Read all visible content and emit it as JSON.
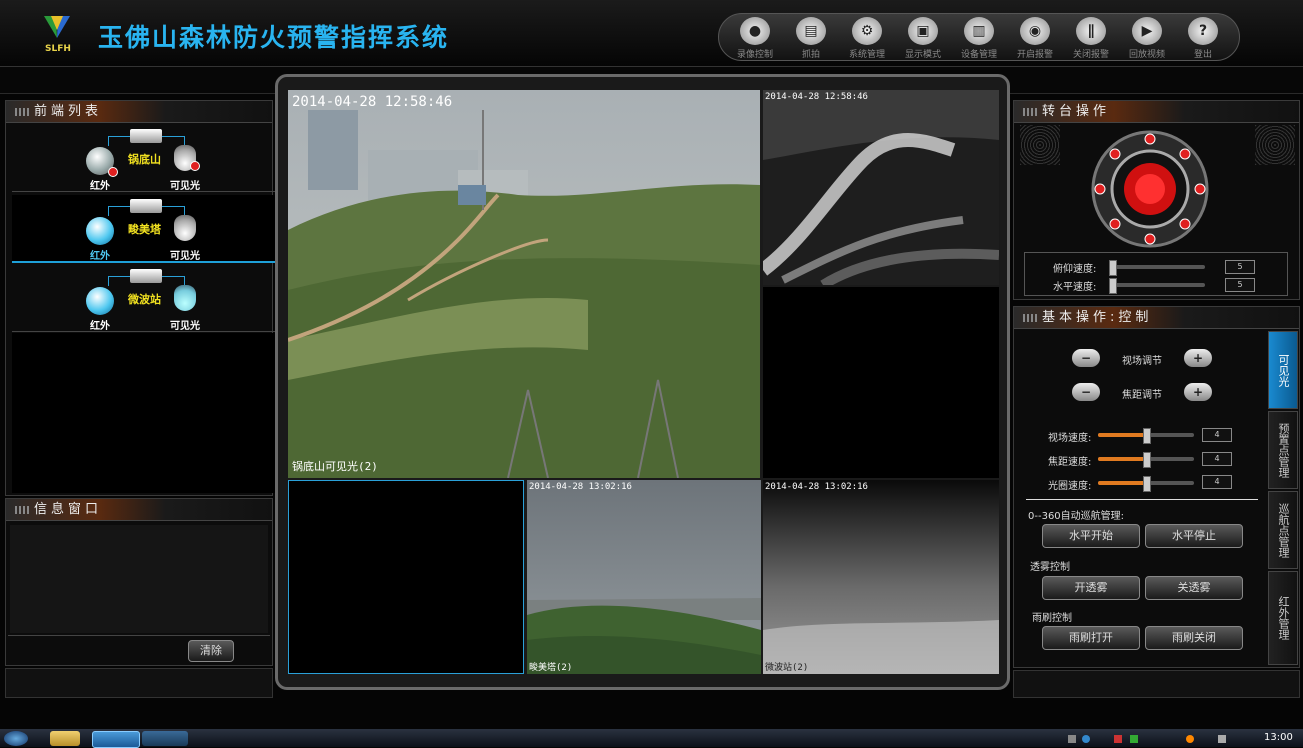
{
  "app": {
    "logo_text": "SLFH",
    "title": "玉佛山森林防火预警指挥系统"
  },
  "toolbar": [
    {
      "label": "录像控制",
      "icon": "video-control-icon",
      "glyph": "●"
    },
    {
      "label": "抓拍",
      "icon": "snapshot-icon",
      "glyph": "▤"
    },
    {
      "label": "系统管理",
      "icon": "system-settings-icon",
      "glyph": "⚙"
    },
    {
      "label": "显示模式",
      "icon": "display-mode-icon",
      "glyph": "▣"
    },
    {
      "label": "设备管理",
      "icon": "device-management-icon",
      "glyph": "▥"
    },
    {
      "label": "开启报警",
      "icon": "alarm-on-icon",
      "glyph": "◉"
    },
    {
      "label": "关闭报警",
      "icon": "alarm-off-icon",
      "glyph": "∥"
    },
    {
      "label": "回放视频",
      "icon": "playback-icon",
      "glyph": "▶"
    },
    {
      "label": "登出",
      "icon": "help-logout-icon",
      "glyph": "?"
    }
  ],
  "front_list": {
    "title": "前端列表",
    "devices": [
      {
        "name": "锅底山",
        "ir_label": "红外",
        "visible_label": "可见光",
        "selected": false,
        "offline": true
      },
      {
        "name": "畯美塔",
        "ir_label": "红外",
        "visible_label": "可见光",
        "selected": true,
        "offline": false
      },
      {
        "name": "微波站",
        "ir_label": "红外",
        "visible_label": "可见光",
        "selected": false,
        "offline": false
      }
    ]
  },
  "info_window": {
    "title": "信息窗口",
    "clear_label": "清除"
  },
  "video": {
    "main_timestamp": "2014-04-28 12:58:46",
    "main_caption": "锅底山可见光(2)",
    "tr_timestamp": "2014-04-28 12:58:46",
    "b2_timestamp": "2014-04-28 13:02:16",
    "b2_caption": "畯美塔(2)",
    "b3_timestamp": "2014-04-28 13:02:16",
    "b3_caption": "微波站(2)"
  },
  "ptz": {
    "title": "转台操作",
    "tilt_label": "俯仰速度:",
    "tilt_value": "5",
    "pan_label": "水平速度:",
    "pan_value": "5"
  },
  "basic": {
    "title": "基本操作:控制",
    "fov_label": "视场调节",
    "focus_label": "焦距调节",
    "minus": "−",
    "plus": "+",
    "speeds": [
      {
        "label": "视场速度:",
        "value": "4",
        "level": 0.5
      },
      {
        "label": "焦距速度:",
        "value": "4",
        "level": 0.5
      },
      {
        "label": "光圈速度:",
        "value": "4",
        "level": 0.5
      }
    ],
    "cruise_label": "0--360自动巡航管理:",
    "cruise_start": "水平开始",
    "cruise_stop": "水平停止",
    "fog_label": "透雾控制",
    "fog_on": "开透雾",
    "fog_off": "关透雾",
    "wiper_label": "雨刷控制",
    "wiper_on": "雨刷打开",
    "wiper_off": "雨刷关闭"
  },
  "side_tabs": [
    "可见光",
    "预置点管理",
    "巡航点管理",
    "红外管理"
  ],
  "taskbar": {
    "clock": "13:00"
  },
  "colors": {
    "title_blue": "#29b4f0",
    "accent_orange": "#e07a20",
    "select_blue": "#1ea0d8"
  }
}
